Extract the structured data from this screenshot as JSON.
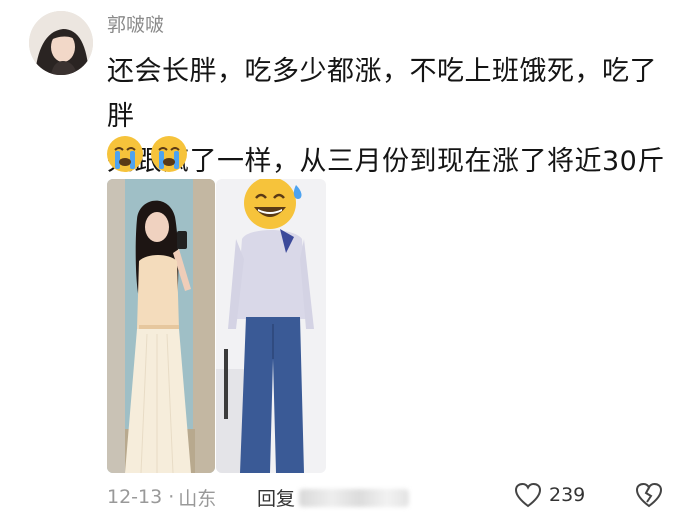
{
  "comment": {
    "username": "郭啵啵",
    "text_line1": "还会长胖，吃多少都涨，不吃上班饿死，吃了胖",
    "text_line2": "死跟疯了一样，从三月份到现在涨了将近30斤",
    "emojis": [
      "crying-face-icon",
      "crying-face-icon"
    ]
  },
  "photos": [
    {
      "name": "before-photo"
    },
    {
      "name": "after-photo"
    }
  ],
  "footer": {
    "date": "12-13",
    "separator": "·",
    "location": "山东",
    "reply_label": "回复",
    "likes": "239"
  },
  "colors": {
    "username": "#8a8a8a",
    "meta": "#999999",
    "emoji_yellow": "#f6c33b",
    "tear_blue": "#4da3f0"
  }
}
